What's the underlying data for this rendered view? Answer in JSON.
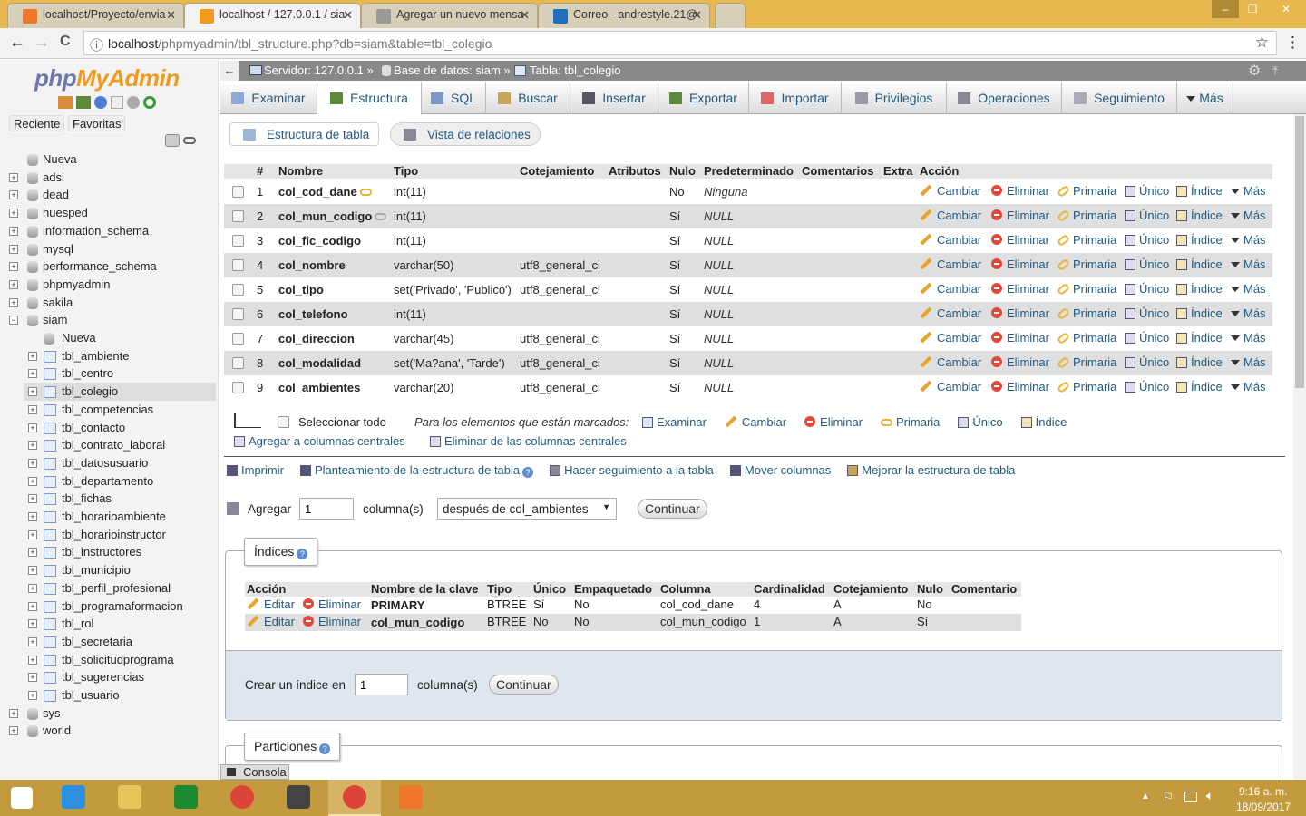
{
  "browser": {
    "tabs": [
      {
        "title": "localhost/Proyecto/envia",
        "icon": "xampp-icon",
        "color": "#f0772a"
      },
      {
        "title": "localhost / 127.0.0.1 / sia",
        "icon": "pma-icon",
        "color": "#f29a1b",
        "active": true
      },
      {
        "title": "Agregar un nuevo mensa",
        "icon": "page-icon",
        "color": "#999999"
      },
      {
        "title": "Correo - andrestyle.21@",
        "icon": "outlook-icon",
        "color": "#1f6fc0"
      }
    ],
    "close_glyph": "✕",
    "url_host": "localhost",
    "url_path": "/phpmyadmin/tbl_structure.php?db=siam&table=tbl_colegio",
    "nav": {
      "back": "←",
      "forward": "→",
      "reload": "C",
      "star": "☆",
      "menu": "⋮",
      "info": "ⓘ"
    },
    "window": {
      "minimize": "–",
      "restore": "❐",
      "close": "✕"
    }
  },
  "sidebar": {
    "logo_php": "php",
    "logo_my": "MyAdmin",
    "recent": "Reciente",
    "favorites": "Favoritas",
    "tree": [
      {
        "label": "Nueva",
        "depth": 0,
        "kind": "new"
      },
      {
        "label": "adsi",
        "depth": 0,
        "kind": "db"
      },
      {
        "label": "dead",
        "depth": 0,
        "kind": "db"
      },
      {
        "label": "huesped",
        "depth": 0,
        "kind": "db"
      },
      {
        "label": "information_schema",
        "depth": 0,
        "kind": "db"
      },
      {
        "label": "mysql",
        "depth": 0,
        "kind": "db"
      },
      {
        "label": "performance_schema",
        "depth": 0,
        "kind": "db"
      },
      {
        "label": "phpmyadmin",
        "depth": 0,
        "kind": "db"
      },
      {
        "label": "sakila",
        "depth": 0,
        "kind": "db"
      },
      {
        "label": "siam",
        "depth": 0,
        "kind": "db",
        "expanded": true
      },
      {
        "label": "Nueva",
        "depth": 1,
        "kind": "new"
      },
      {
        "label": "tbl_ambiente",
        "depth": 1,
        "kind": "table"
      },
      {
        "label": "tbl_centro",
        "depth": 1,
        "kind": "table"
      },
      {
        "label": "tbl_colegio",
        "depth": 1,
        "kind": "table",
        "selected": true
      },
      {
        "label": "tbl_competencias",
        "depth": 1,
        "kind": "table"
      },
      {
        "label": "tbl_contacto",
        "depth": 1,
        "kind": "table"
      },
      {
        "label": "tbl_contrato_laboral",
        "depth": 1,
        "kind": "table"
      },
      {
        "label": "tbl_datosusuario",
        "depth": 1,
        "kind": "table"
      },
      {
        "label": "tbl_departamento",
        "depth": 1,
        "kind": "table"
      },
      {
        "label": "tbl_fichas",
        "depth": 1,
        "kind": "table"
      },
      {
        "label": "tbl_horarioambiente",
        "depth": 1,
        "kind": "table"
      },
      {
        "label": "tbl_horarioinstructor",
        "depth": 1,
        "kind": "table"
      },
      {
        "label": "tbl_instructores",
        "depth": 1,
        "kind": "table"
      },
      {
        "label": "tbl_municipio",
        "depth": 1,
        "kind": "table"
      },
      {
        "label": "tbl_perfil_profesional",
        "depth": 1,
        "kind": "table"
      },
      {
        "label": "tbl_programaformacion",
        "depth": 1,
        "kind": "table"
      },
      {
        "label": "tbl_rol",
        "depth": 1,
        "kind": "table"
      },
      {
        "label": "tbl_secretaria",
        "depth": 1,
        "kind": "table"
      },
      {
        "label": "tbl_solicitudprograma",
        "depth": 1,
        "kind": "table"
      },
      {
        "label": "tbl_sugerencias",
        "depth": 1,
        "kind": "table"
      },
      {
        "label": "tbl_usuario",
        "depth": 1,
        "kind": "table"
      },
      {
        "label": "sys",
        "depth": 0,
        "kind": "db"
      },
      {
        "label": "world",
        "depth": 0,
        "kind": "db"
      }
    ]
  },
  "breadcrumb": {
    "server": "Servidor: 127.0.0.1 »",
    "database": "Base de datos: siam »",
    "table": "Tabla: tbl_colegio",
    "back": "←"
  },
  "tabs": [
    "Examinar",
    "Estructura",
    "SQL",
    "Buscar",
    "Insertar",
    "Exportar",
    "Importar",
    "Privilegios",
    "Operaciones",
    "Seguimiento",
    "Más"
  ],
  "active_tab": "Estructura",
  "subtabs": [
    "Estructura de tabla",
    "Vista de relaciones"
  ],
  "structure": {
    "headers": [
      "#",
      "Nombre",
      "Tipo",
      "Cotejamiento",
      "Atributos",
      "Nulo",
      "Predeterminado",
      "Comentarios",
      "Extra",
      "Acción"
    ],
    "actions": [
      "Cambiar",
      "Eliminar",
      "Primaria",
      "Único",
      "Índice",
      "Más"
    ],
    "rows": [
      {
        "n": "1",
        "name": "col_cod_dane",
        "type": "int(11)",
        "collation": "",
        "null": "No",
        "default": "Ninguna",
        "key": "primary"
      },
      {
        "n": "2",
        "name": "col_mun_codigo",
        "type": "int(11)",
        "collation": "",
        "null": "Sí",
        "default": "NULL",
        "key": "index"
      },
      {
        "n": "3",
        "name": "col_fic_codigo",
        "type": "int(11)",
        "collation": "",
        "null": "Sí",
        "default": "NULL"
      },
      {
        "n": "4",
        "name": "col_nombre",
        "type": "varchar(50)",
        "collation": "utf8_general_ci",
        "null": "Sí",
        "default": "NULL"
      },
      {
        "n": "5",
        "name": "col_tipo",
        "type": "set('Privado', 'Publico')",
        "collation": "utf8_general_ci",
        "null": "Sí",
        "default": "NULL"
      },
      {
        "n": "6",
        "name": "col_telefono",
        "type": "int(11)",
        "collation": "",
        "null": "Sí",
        "default": "NULL"
      },
      {
        "n": "7",
        "name": "col_direccion",
        "type": "varchar(45)",
        "collation": "utf8_general_ci",
        "null": "Sí",
        "default": "NULL"
      },
      {
        "n": "8",
        "name": "col_modalidad",
        "type": "set('Ma?ana', 'Tarde')",
        "collation": "utf8_general_ci",
        "null": "Sí",
        "default": "NULL"
      },
      {
        "n": "9",
        "name": "col_ambientes",
        "type": "varchar(20)",
        "collation": "utf8_general_ci",
        "null": "Sí",
        "default": "NULL"
      }
    ],
    "select_all": "Seleccionar todo",
    "with_selected": "Para los elementos que están marcados:",
    "bulk_actions": [
      "Examinar",
      "Cambiar",
      "Eliminar",
      "Primaria",
      "Único",
      "Índice"
    ],
    "central_add": "Agregar a columnas centrales",
    "central_remove": "Eliminar de las columnas centrales"
  },
  "tools": [
    "Imprimir",
    "Planteamiento de la estructura de tabla",
    "Hacer seguimiento a la tabla",
    "Mover columnas",
    "Mejorar la estructura de tabla"
  ],
  "add_columns": {
    "label": "Agregar",
    "value": "1",
    "unit": "columna(s)",
    "position": "después de col_ambientes",
    "submit": "Continuar"
  },
  "indexes": {
    "legend": "Índices",
    "headers": [
      "Acción",
      "Nombre de la clave",
      "Tipo",
      "Único",
      "Empaquetado",
      "Columna",
      "Cardinalidad",
      "Cotejamiento",
      "Nulo",
      "Comentario"
    ],
    "edit": "Editar",
    "drop": "Eliminar",
    "rows": [
      {
        "name": "PRIMARY",
        "type": "BTREE",
        "unique": "Sí",
        "packed": "No",
        "column": "col_cod_dane",
        "cardinality": "4",
        "collation": "A",
        "null": "No",
        "comment": ""
      },
      {
        "name": "col_mun_codigo",
        "type": "BTREE",
        "unique": "No",
        "packed": "No",
        "column": "col_mun_codigo",
        "cardinality": "1",
        "collation": "A",
        "null": "Sí",
        "comment": ""
      }
    ],
    "create_label": "Crear un índice en",
    "create_value": "1",
    "create_unit": "columna(s)",
    "create_submit": "Continuar"
  },
  "partitions": {
    "legend": "Particiones"
  },
  "console": "Consola",
  "taskbar": {
    "time": "9:16 a. m.",
    "date": "18/09/2017",
    "apps": [
      "start",
      "ie",
      "explorer",
      "store",
      "chrome",
      "sublime",
      "chrome-active",
      "xampp"
    ]
  }
}
